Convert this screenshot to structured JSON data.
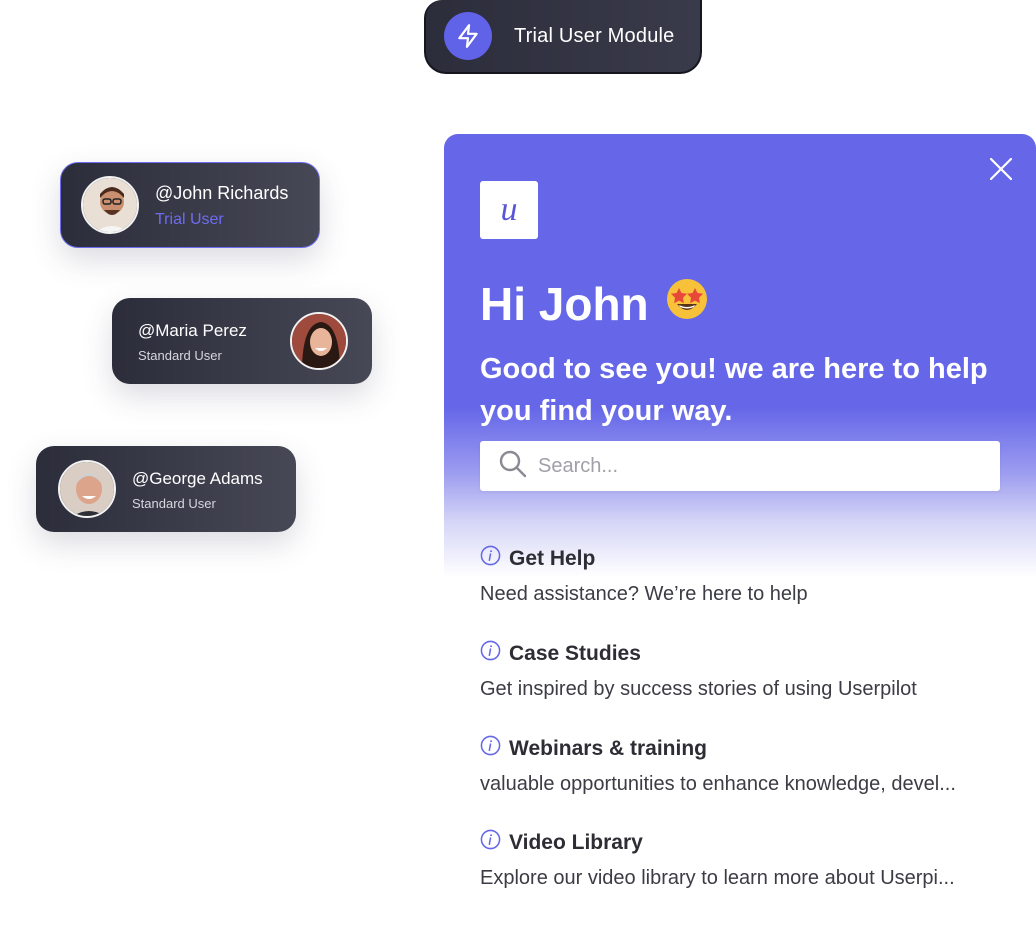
{
  "module": {
    "label": "Trial User Module",
    "accent": "#6062e8"
  },
  "users": [
    {
      "name": "@John Richards",
      "role": "Trial User"
    },
    {
      "name": "@Maria Perez",
      "role": "Standard User"
    },
    {
      "name": "@George Adams",
      "role": "Standard User"
    }
  ],
  "panel": {
    "greeting": "Hi John",
    "emoji": "🤩",
    "subtitle": "Good to see you! we are here to help you find your way.",
    "search_placeholder": "Search...",
    "items": [
      {
        "title": "Get Help",
        "desc": "Need assistance? We’re here to help"
      },
      {
        "title": "Case Studies",
        "desc": "Get inspired by success stories of using Userpilot"
      },
      {
        "title": "Webinars & training",
        "desc": "valuable opportunities to enhance knowledge, devel..."
      },
      {
        "title": "Video Library",
        "desc": "Explore our video library to learn more about Userpi..."
      }
    ],
    "logo_letter": "u",
    "brand_color": "#6567e8"
  }
}
